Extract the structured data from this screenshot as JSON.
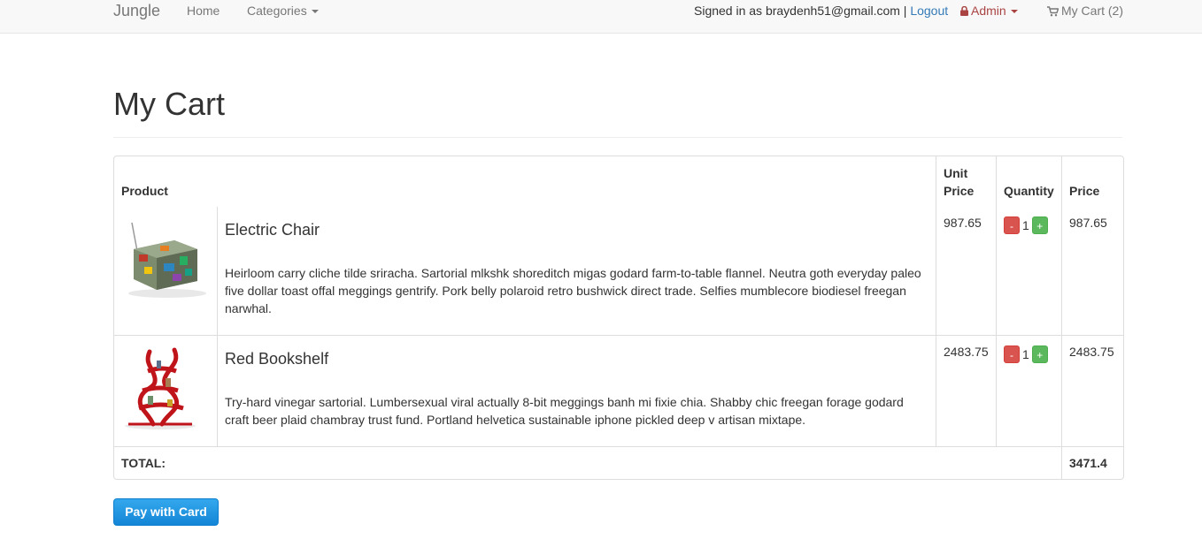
{
  "nav": {
    "brand": "Jungle",
    "home": "Home",
    "categories": "Categories",
    "signed_in_text": "Signed in as braydenh51@gmail.com |",
    "logout": "Logout",
    "admin": "Admin",
    "cart": "My Cart (2)"
  },
  "page": {
    "title": "My Cart"
  },
  "table": {
    "headers": {
      "product": "Product",
      "unit_price": "Unit Price",
      "quantity": "Quantity",
      "price": "Price"
    },
    "rows": [
      {
        "name": "Electric Chair",
        "description": "Heirloom carry cliche tilde sriracha. Sartorial mlkshk shoreditch migas godard farm-to-table flannel. Neutra goth everyday paleo five dollar toast offal meggings gentrify. Pork belly polaroid retro bushwick direct trade. Selfies mumblecore biodiesel freegan narwhal.",
        "unit_price": "987.65",
        "quantity": "1",
        "price": "987.65",
        "minus": "-",
        "plus": "+"
      },
      {
        "name": "Red Bookshelf",
        "description": "Try-hard vinegar sartorial. Lumbersexual viral actually 8-bit meggings banh mi fixie chia. Shabby chic freegan forage godard craft beer plaid chambray trust fund. Portland helvetica sustainable iphone pickled deep v artisan mixtape.",
        "unit_price": "2483.75",
        "quantity": "1",
        "price": "2483.75",
        "minus": "-",
        "plus": "+"
      }
    ],
    "total_label": "TOTAL:",
    "total_value": "3471.4"
  },
  "pay_button": "Pay with Card",
  "colors": {
    "link": "#337ab7",
    "admin": "#a94442",
    "minus_button": "#d9534f",
    "plus_button": "#5cb85c",
    "pay_button": "#1f93e0"
  },
  "icons": [
    "caret-down-icon",
    "lock-icon",
    "shopping-cart-icon"
  ]
}
